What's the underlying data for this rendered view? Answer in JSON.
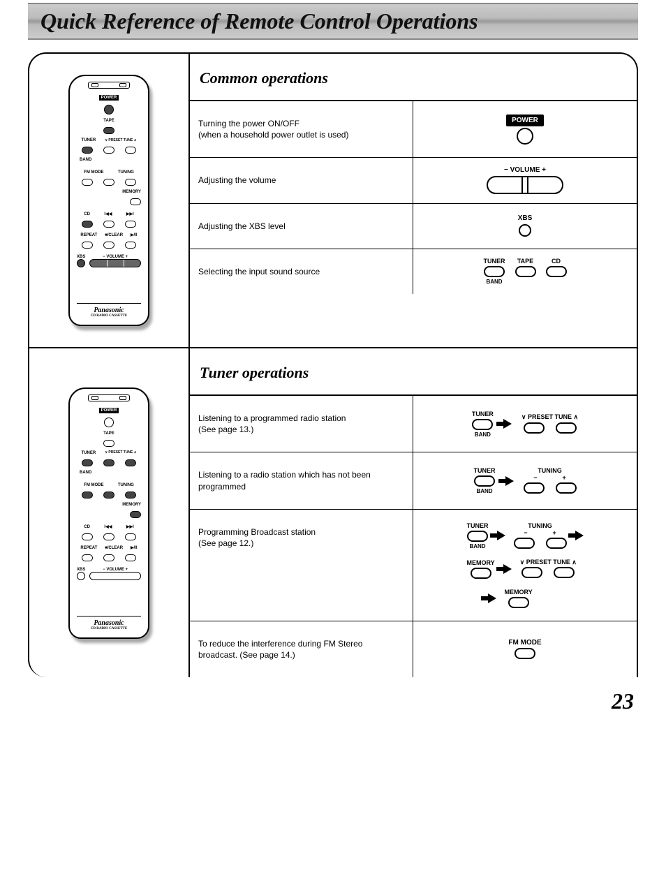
{
  "title": "Quick Reference of Remote Control Operations",
  "page_number": "23",
  "remote_brand": "Panasonic",
  "remote_brand_sub": "CD RADIO CASSETTE",
  "remote_labels": {
    "power": "POWER",
    "tape": "TAPE",
    "tuner": "TUNER",
    "band": "BAND",
    "preset": "∨ PRESET TUNE ∧",
    "fm_mode": "FM MODE",
    "tuning": "TUNING",
    "memory": "MEMORY",
    "cd": "CD",
    "prev": "I◀◀",
    "next": "▶▶I",
    "repeat": "REPEAT",
    "clear": "■/CLEAR",
    "playpause": "▶/II",
    "xbs": "XBS",
    "volume": "− VOLUME +"
  },
  "sections": [
    {
      "heading": "Common operations",
      "rows": [
        {
          "desc_lines": [
            "Turning the power ON/OFF",
            "(when a household power outlet is used)"
          ],
          "graphic": "power"
        },
        {
          "desc_lines": [
            "Adjusting the volume"
          ],
          "graphic": "volume"
        },
        {
          "desc_lines": [
            "Adjusting the XBS level"
          ],
          "graphic": "xbs"
        },
        {
          "desc_lines": [
            "Selecting the input sound source"
          ],
          "graphic": "sources"
        }
      ]
    },
    {
      "heading": "Tuner operations",
      "rows": [
        {
          "desc_lines": [
            "Listening to a programmed radio station",
            "(See page 13.)"
          ],
          "graphic": "tuner_preset"
        },
        {
          "desc_lines": [
            "Listening to a radio station which has not been",
            "programmed"
          ],
          "graphic": "tuner_tuning"
        },
        {
          "desc_lines": [
            "Programming Broadcast station",
            "(See page 12.)"
          ],
          "graphic": "programming"
        },
        {
          "desc_lines": [
            "To reduce the interference during FM Stereo",
            "broadcast. (See page 14.)"
          ],
          "graphic": "fm_mode"
        }
      ]
    }
  ],
  "graphic_labels": {
    "power": "POWER",
    "volume": "− VOLUME +",
    "xbs": "XBS",
    "tuner": "TUNER",
    "band": "BAND",
    "tape": "TAPE",
    "cd": "CD",
    "preset": "∨ PRESET TUNE ∧",
    "tuning": "TUNING",
    "minus": "−",
    "plus": "+",
    "memory": "MEMORY",
    "fm_mode": "FM MODE"
  }
}
